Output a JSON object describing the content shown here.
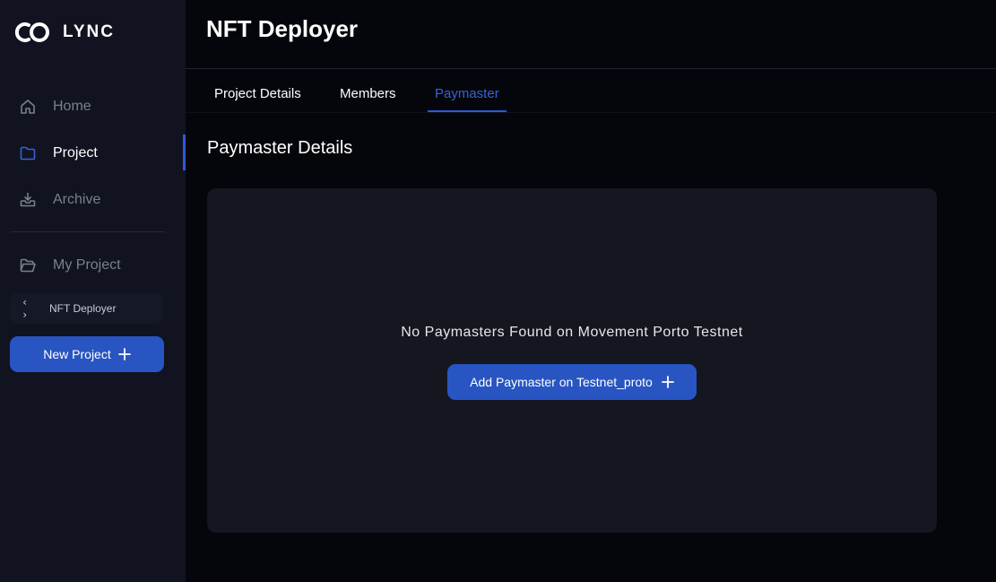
{
  "brand": {
    "name": "LYNC"
  },
  "header": {
    "title": "NFT Deployer"
  },
  "sidebar": {
    "nav": [
      {
        "label": "Home",
        "icon": "home-icon"
      },
      {
        "label": "Project",
        "icon": "folder-icon",
        "active": true
      },
      {
        "label": "Archive",
        "icon": "archive-icon"
      }
    ],
    "my_project": {
      "label": "My Project",
      "icon": "folder-open-icon"
    },
    "projects": [
      {
        "label": "NFT Deployer",
        "icon": "code-icon"
      }
    ],
    "new_project_label": "New Project"
  },
  "tabs": [
    {
      "label": "Project Details"
    },
    {
      "label": "Members"
    },
    {
      "label": "Paymaster",
      "active": true
    }
  ],
  "paymaster": {
    "section_title": "Paymaster Details",
    "empty_message": "No Paymasters Found on Movement Porto Testnet",
    "add_button_label": "Add Paymaster on Testnet_proto"
  },
  "colors": {
    "accent": "#2855c2",
    "active_tab": "#3563d6",
    "background": "#05060c",
    "sidebar": "#111320",
    "panel": "#141620"
  }
}
